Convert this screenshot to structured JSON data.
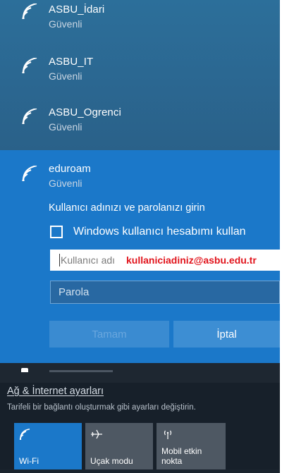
{
  "networks": [
    {
      "name": "ASBU_İdari",
      "status": "Güvenli"
    },
    {
      "name": "ASBU_IT",
      "status": "Güvenli"
    },
    {
      "name": "ASBU_Ogrenci",
      "status": "Güvenli"
    }
  ],
  "selected": {
    "name": "eduroam",
    "status": "Güvenli",
    "prompt": "Kullanıcı adınızı ve parolanızı girin",
    "checkbox_label": "Windows kullanıcı hesabımı kullan",
    "checkbox_checked": false,
    "username_placeholder": "Kullanıcı adı",
    "username_hint": "kullaniciadiniz@asbu.edu.tr",
    "password_placeholder": "Parola",
    "ok_label": "Tamam",
    "cancel_label": "İptal"
  },
  "settings": {
    "link": "Ağ & İnternet ayarları",
    "description": "Tarifeli bir bağlantı oluşturmak gibi ayarları değiştirin."
  },
  "tiles": [
    {
      "label": "Wi-Fi",
      "icon": "wifi-icon",
      "active": true
    },
    {
      "label": "Uçak modu",
      "icon": "airplane-icon",
      "active": false
    },
    {
      "label": "Mobil etkin nokta",
      "icon": "hotspot-icon",
      "active": false
    }
  ],
  "colors": {
    "accent": "#1b78c9",
    "hint_red": "#e1141c",
    "panel_dark": "#17202a"
  }
}
